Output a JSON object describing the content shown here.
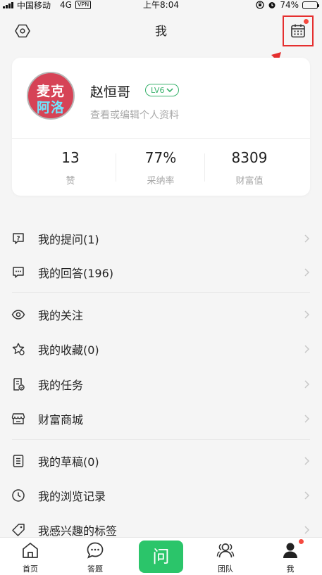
{
  "status_bar": {
    "carrier": "中国移动",
    "network": "4G",
    "vpn": "VPN",
    "time": "上午8:04",
    "battery_percent": "74%",
    "battery_level": 0.74
  },
  "header": {
    "title": "我",
    "settings_icon": "hexagon-settings-icon",
    "calendar_icon": "calendar-icon",
    "calendar_has_notification": true,
    "highlight_color": "#e52f2f"
  },
  "profile": {
    "avatar_line1": "麦克",
    "avatar_line2": "阿洛",
    "username": "赵恒哥",
    "level": "LV6",
    "subtitle": "查看或编辑个人资料",
    "stats": [
      {
        "value": "13",
        "label": "赞"
      },
      {
        "value": "77%",
        "label": "采纳率"
      },
      {
        "value": "8309",
        "label": "财富值"
      }
    ]
  },
  "menu": {
    "items": [
      {
        "label": "我的提问(1)",
        "icon": "question-bubble-icon"
      },
      {
        "label": "我的回答(196)",
        "icon": "answer-bubble-icon"
      },
      {
        "label": "我的关注",
        "icon": "eye-icon"
      },
      {
        "label": "我的收藏(0)",
        "icon": "star-icon"
      },
      {
        "label": "我的任务",
        "icon": "task-doc-icon"
      },
      {
        "label": "财富商城",
        "icon": "store-icon"
      },
      {
        "label": "我的草稿(0)",
        "icon": "draft-doc-icon"
      },
      {
        "label": "我的浏览记录",
        "icon": "clock-icon"
      },
      {
        "label": "我感兴趣的标签",
        "icon": "tag-icon"
      }
    ]
  },
  "tabbar": {
    "tabs": [
      {
        "label": "首页",
        "icon": "home-icon"
      },
      {
        "label": "答题",
        "icon": "answer-chat-icon"
      },
      {
        "label": "问",
        "icon": "ask-button"
      },
      {
        "label": "团队",
        "icon": "team-icon"
      },
      {
        "label": "我",
        "icon": "person-icon"
      }
    ],
    "accent_color": "#2bc56a"
  }
}
